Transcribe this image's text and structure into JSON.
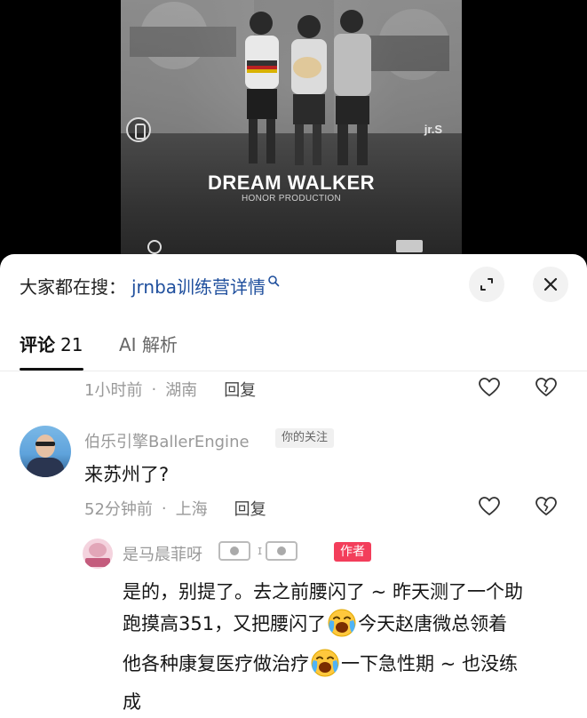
{
  "video": {
    "title": "DREAM WALKER",
    "subtitle": "HONOR PRODUCTION",
    "watermark": "jr.S"
  },
  "search": {
    "prefix": "大家都在搜：",
    "query": "jrnba训练营详情"
  },
  "tabs": [
    {
      "label": "评论",
      "count": "21"
    },
    {
      "label": "AI 解析"
    }
  ],
  "comments": [
    {
      "time": "1小时前",
      "location": "湖南",
      "reply_label": "回复"
    },
    {
      "username": "伯乐引擎BallerEngine",
      "follow_tag": "你的关注",
      "text": "来苏州了?",
      "time": "52分钟前",
      "location": "上海",
      "reply_label": "回复"
    }
  ],
  "reply": {
    "username": "是马晨菲呀",
    "author_badge": "作者",
    "line1": "是的，别提了。去之前腰闪了 ~ 昨天测了一个助",
    "line2a": "跑摸高351，又把腰闪了",
    "line2b": "今天赵唐微总领着",
    "line3a": "他各种康复医疗做治疗",
    "line3b": "一下急性期 ~ 也没练",
    "line4": "成"
  },
  "icons": {
    "search": "search-icon",
    "expand": "expand-icon",
    "close": "close-icon",
    "like": "heart-icon",
    "dislike": "broken-heart-icon",
    "emoji": "crying-face-emoji"
  }
}
